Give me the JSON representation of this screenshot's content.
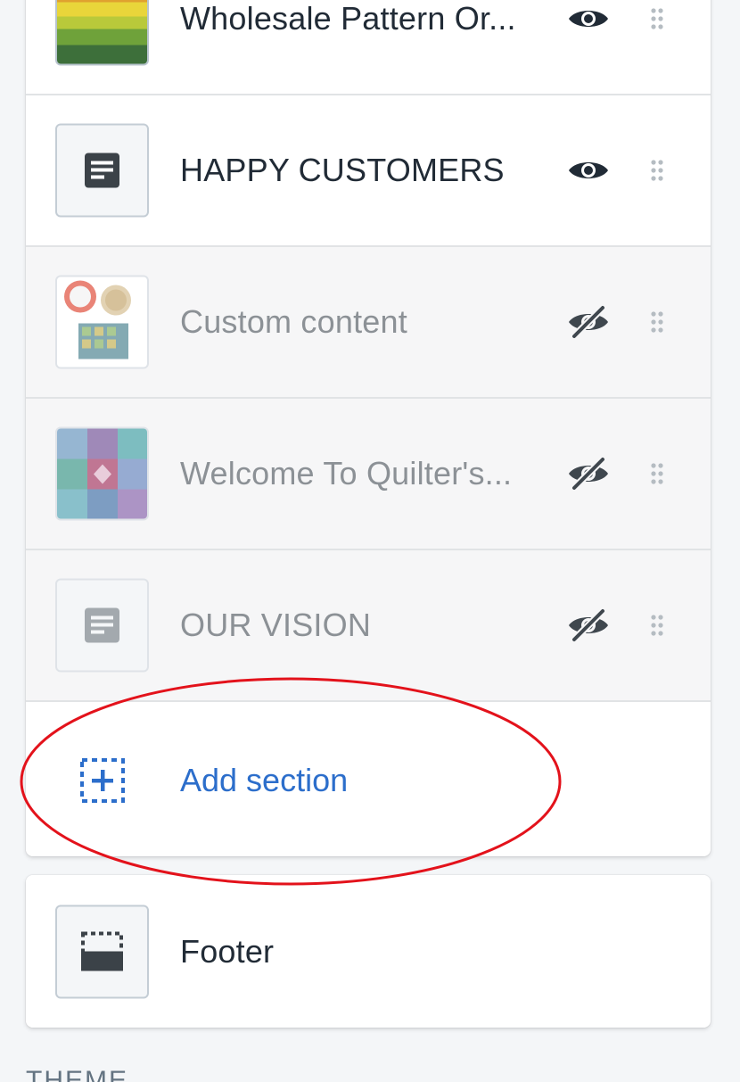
{
  "sections": [
    {
      "label": "Wholesale Pattern Or...",
      "visible": true,
      "thumb": "fabric-stack-image"
    },
    {
      "label": "HAPPY CUSTOMERS",
      "visible": true,
      "thumb": "text-block-icon"
    },
    {
      "label": "Custom content",
      "visible": false,
      "thumb": "custom-content-image"
    },
    {
      "label": "Welcome To Quilter's...",
      "visible": false,
      "thumb": "quilt-image"
    },
    {
      "label": "OUR VISION",
      "visible": false,
      "thumb": "text-block-icon"
    }
  ],
  "add_section": {
    "label": "Add section",
    "icon": "add-section-icon"
  },
  "footer": {
    "label": "Footer",
    "icon": "footer-layout-icon"
  },
  "theme_label": "THEME",
  "icons": {
    "visible": "eye-icon",
    "hidden": "eye-slash-icon",
    "drag": "drag-handle-icon"
  },
  "colors": {
    "accent": "#2c6ecb",
    "annotation": "#e3121b",
    "text": "#212b36",
    "muted_text": "#8c9196"
  }
}
